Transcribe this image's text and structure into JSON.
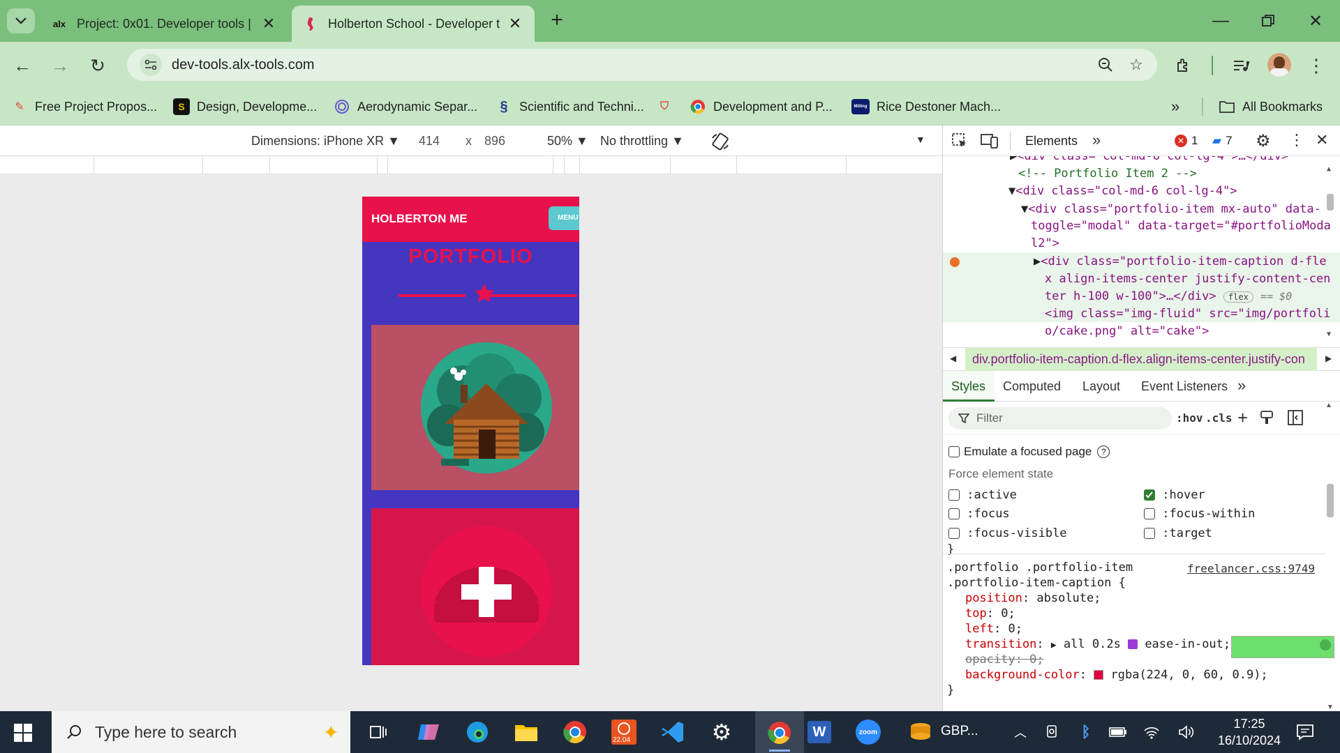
{
  "browser": {
    "tabs": [
      {
        "title": "Project: 0x01. Developer tools |",
        "favicon": "alx",
        "active": false
      },
      {
        "title": "Holberton School - Developer t",
        "favicon": "seahorse-icon",
        "active": true
      }
    ],
    "url": "dev-tools.alx-tools.com",
    "bookmarks": [
      {
        "label": "Free Project Propos..."
      },
      {
        "label": "Design, Developme..."
      },
      {
        "label": "Aerodynamic Separ..."
      },
      {
        "label": "Scientific and Techni..."
      },
      {
        "label": "Development and P..."
      },
      {
        "label": "Rice Destoner Mach..."
      }
    ],
    "all_bookmarks": "All Bookmarks",
    "more_bookmarks": "»"
  },
  "device_toolbar": {
    "dimensions_label": "Dimensions: iPhone XR",
    "width": "414",
    "times": "x",
    "height": "896",
    "zoom": "50%",
    "throttling": "No throttling"
  },
  "page": {
    "brand": "HOLBERTON ME",
    "menu": "MENU",
    "section_title": "PORTFOLIO"
  },
  "devtools": {
    "panel": "Elements",
    "error_count": "1",
    "message_count": "7",
    "dom_lines": [
      {
        "t": "<div class=\"col-md-6 col-lg-4\">…</div>"
      },
      {
        "t": "<!-- Portfolio Item 2 -->"
      },
      {
        "t": "<div class=\"col-md-6 col-lg-4\">"
      },
      {
        "t": "<div class=\"portfolio-item mx-auto\" data-"
      },
      {
        "t": "toggle=\"modal\" data-target=\"#portfolioModa"
      },
      {
        "t": "l2\">"
      },
      {
        "t": "<div class=\"portfolio-item-caption d-fle"
      },
      {
        "t": "x align-items-center justify-content-cen"
      },
      {
        "t": "ter h-100 w-100\">…</div>"
      },
      {
        "t": "<img class=\"img-fluid\" src=\"img/portfoli"
      },
      {
        "t": "o/cake.png\" alt=\"cake\">"
      }
    ],
    "flex_badge": "flex",
    "dollar0": "== $0",
    "breadcrumb": "div.portfolio-item-caption.d-flex.align-items-center.justify-con",
    "subtabs": [
      "Styles",
      "Computed",
      "Layout",
      "Event Listeners"
    ],
    "filter_placeholder": "Filter",
    "hov": ":hov",
    "cls": ".cls",
    "emulate_focus": "Emulate a focused page",
    "force_state_label": "Force element state",
    "states": [
      {
        "label": ":active",
        "checked": false
      },
      {
        "label": ":hover",
        "checked": true
      },
      {
        "label": ":focus",
        "checked": false
      },
      {
        "label": ":focus-within",
        "checked": false
      },
      {
        "label": ":focus-visible",
        "checked": false
      },
      {
        "label": ":target",
        "checked": false
      }
    ],
    "close_brace": "}",
    "rule": {
      "selector1": ".portfolio .portfolio-item",
      "selector2": ".portfolio-item-caption {",
      "source": "freelancer.css:9749",
      "decls": [
        {
          "prop": "position",
          "value": "absolute;"
        },
        {
          "prop": "top",
          "value": "0;"
        },
        {
          "prop": "left",
          "value": "0;"
        },
        {
          "prop": "transition",
          "value": "all 0.2s"
        },
        {
          "prop": "opacity",
          "value": "0;"
        },
        {
          "prop": "background-color",
          "value": "rgba(224, 0, 60, 0.9);"
        }
      ],
      "transition_timing": "ease-in-out;",
      "swatch_color": "#e0003c"
    }
  },
  "taskbar": {
    "search_placeholder": "Type here to search",
    "currency_label": "GBP...",
    "time": "17:25",
    "date": "16/10/2024",
    "ubuntu_badge": "22.04"
  },
  "colors": {
    "chrome_green": "#7bbf7d",
    "toolbar_green": "#c7e6c6",
    "page_red": "#e8114b",
    "page_purple": "#4536c0"
  }
}
